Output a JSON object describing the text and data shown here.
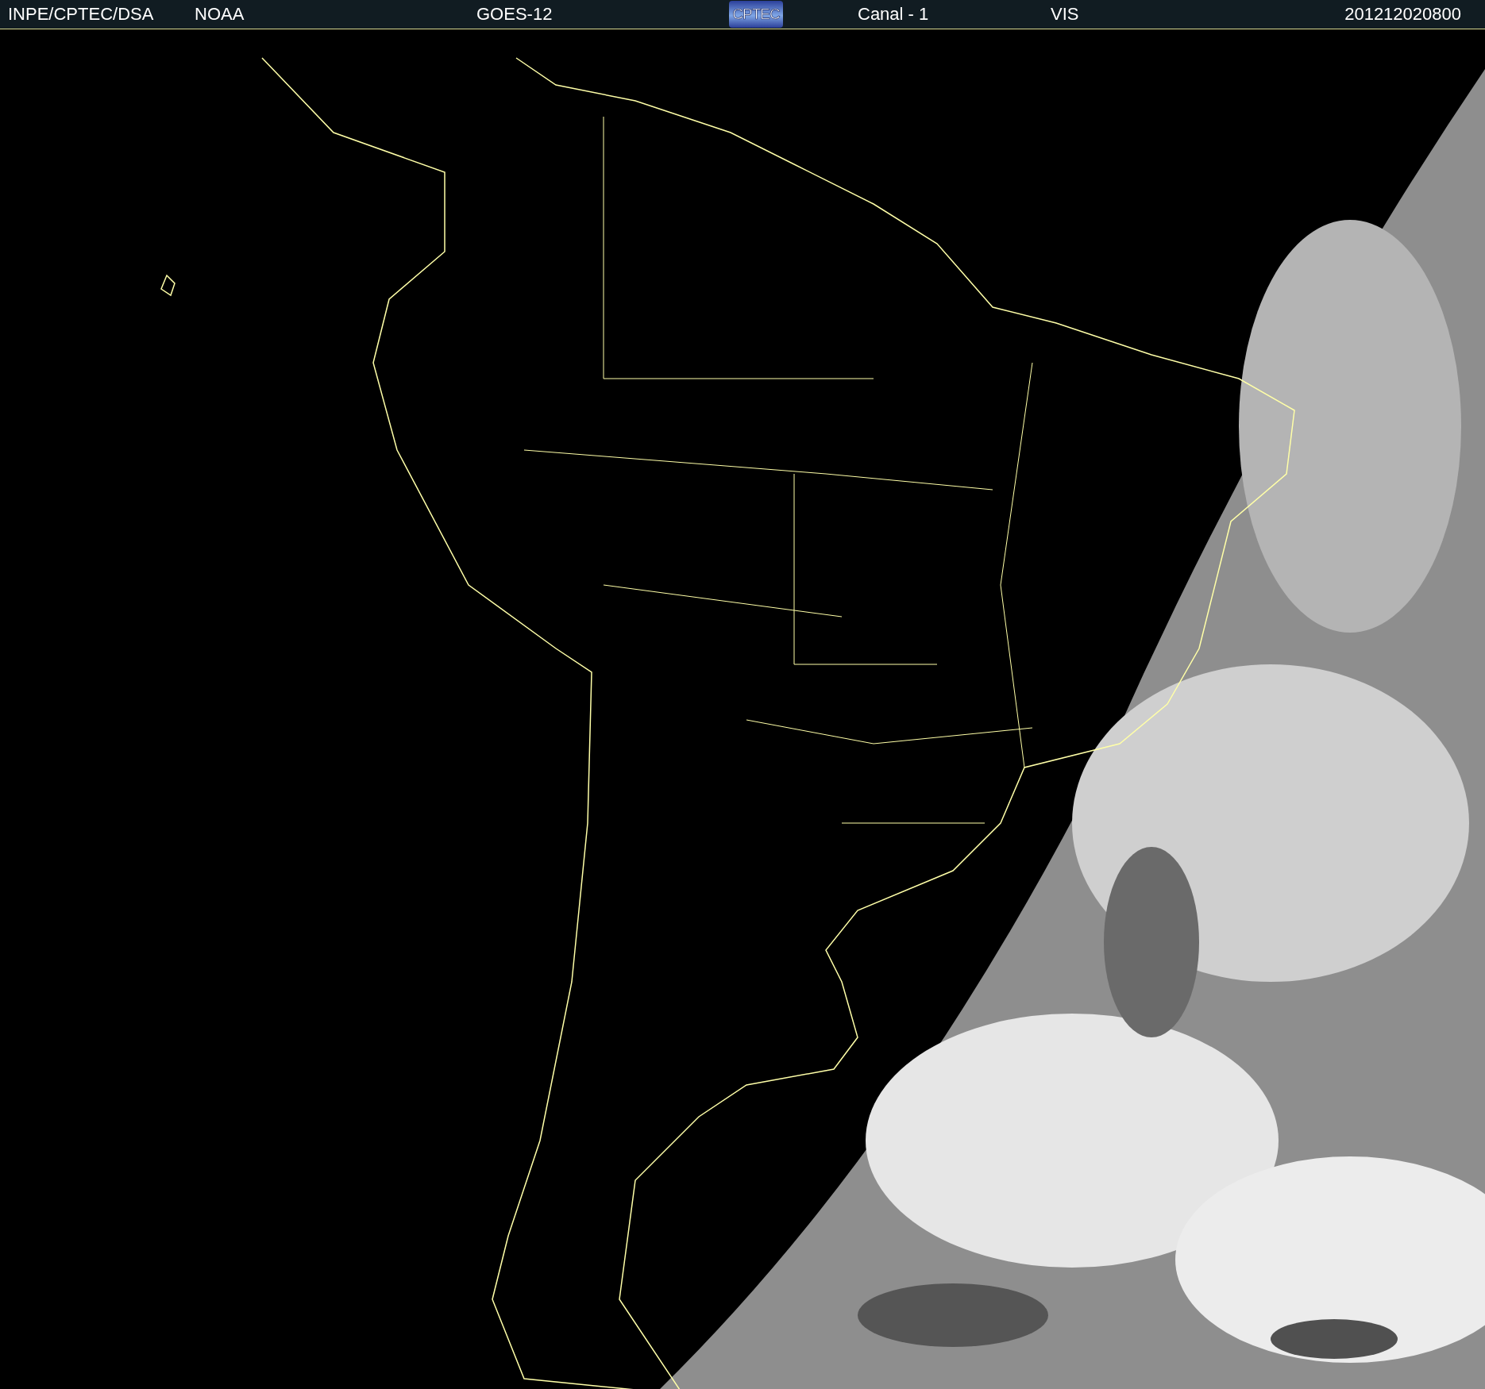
{
  "header": {
    "source": "INPE/CPTEC/DSA",
    "agency": "NOAA",
    "satellite": "GOES-12",
    "logo": "CPTEC",
    "channel": "Canal - 1",
    "band": "VIS",
    "timestamp": "201212020800"
  }
}
